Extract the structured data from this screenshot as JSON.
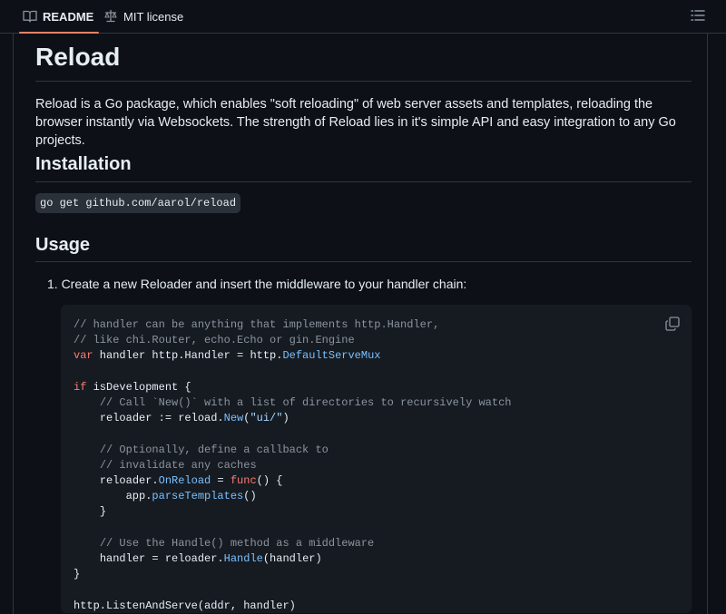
{
  "tabs": {
    "readme_label": "README",
    "license_label": "MIT license"
  },
  "readme": {
    "title": "Reload",
    "intro": "Reload is a Go package, which enables \"soft reloading\" of web server assets and templates, reloading the browser instantly via Websockets. The strength of Reload lies in it's simple API and easy integration to any Go projects.",
    "installation_heading": "Installation",
    "install_command": "go get github.com/aarol/reload",
    "usage_heading": "Usage",
    "step1": "1. Create a new Reloader and insert the middleware to your handler chain:"
  },
  "code": {
    "l1": "// handler can be anything that implements http.Handler,",
    "l2": "// like chi.Router, echo.Echo or gin.Engine",
    "l3_kw": "var",
    "l3_mid": " handler http.Handler = http.",
    "l3_val": "DefaultServeMux",
    "l4_kw": "if",
    "l4_rest": " isDevelopment {",
    "l5": "// Call `New()` with a list of directories to recursively watch",
    "l6_a": "reloader := reload.",
    "l6_fn": "New",
    "l6_b": "(",
    "l6_str": "\"ui/\"",
    "l6_c": ")",
    "l7": "// Optionally, define a callback to",
    "l8": "// invalidate any caches",
    "l9_a": "reloader.",
    "l9_fn": "OnReload",
    "l9_b": " = ",
    "l9_kw": "func",
    "l9_c": "() {",
    "l10_a": "app.",
    "l10_fn": "parseTemplates",
    "l10_b": "()",
    "l11": "}",
    "l12": "// Use the Handle() method as a middleware",
    "l13_a": "handler = reloader.",
    "l13_fn": "Handle",
    "l13_b": "(handler)",
    "l14": "}",
    "l15": "http.ListenAndServe(addr, handler)"
  }
}
